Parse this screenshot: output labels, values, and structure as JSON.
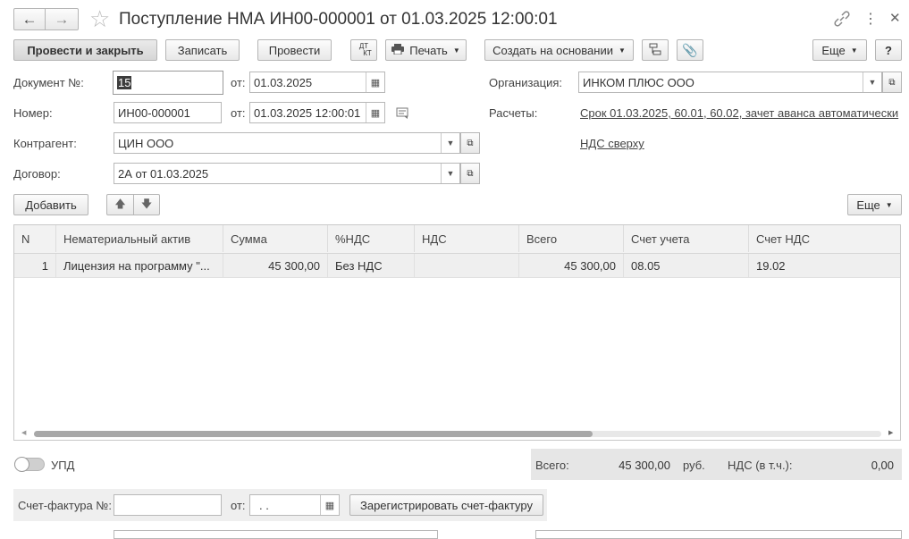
{
  "title": "Поступление НМА ИН00-000001 от 01.03.2025 12:00:01",
  "toolbar": {
    "post_close": "Провести и закрыть",
    "save": "Записать",
    "post": "Провести",
    "dtkt_top": "ДТ",
    "dtkt_bottom": "КТ",
    "print": "Печать",
    "create_based": "Создать на основании",
    "more": "Еще",
    "help": "?"
  },
  "form": {
    "doc_num_label": "Документ №:",
    "doc_num_value": "15",
    "from_label": "от:",
    "doc_date": "01.03.2025",
    "number_label": "Номер:",
    "number_value": "ИН00-000001",
    "number_date": "01.03.2025 12:00:01",
    "org_label": "Организация:",
    "org_value": "ИНКОМ ПЛЮС ООО",
    "calc_label": "Расчеты:",
    "calc_link": "Срок 01.03.2025, 60.01, 60.02, зачет аванса автоматически",
    "vat_link": "НДС сверху",
    "counterparty_label": "Контрагент:",
    "counterparty_value": "ЦИН ООО",
    "contract_label": "Договор:",
    "contract_value": "2А от 01.03.2025"
  },
  "table_toolbar": {
    "add": "Добавить",
    "more": "Еще"
  },
  "table": {
    "columns": [
      "N",
      "Нематериальный актив",
      "Сумма",
      "%НДС",
      "НДС",
      "Всего",
      "Счет учета",
      "Счет НДС"
    ],
    "rows": [
      [
        "1",
        "Лицензия на программу \"...",
        "45 300,00",
        "Без НДС",
        "",
        "45 300,00",
        "08.05",
        "19.02"
      ]
    ]
  },
  "bottom": {
    "upd_label": "УПД",
    "total_label": "Всего:",
    "total_value": "45 300,00",
    "currency": "руб.",
    "vat_label": "НДС (в т.ч.):",
    "vat_value": "0,00",
    "invoice_label": "Счет-фактура №:",
    "invoice_from": "от:",
    "invoice_date": " .  .",
    "register_btn": "Зарегистрировать счет-фактуру"
  },
  "colors": {
    "grid_header": "#f2f2f2",
    "selected_row": "#efefef",
    "total_panel": "#e6e6e6"
  },
  "icons": [
    "back-arrow-icon",
    "forward-arrow-icon",
    "star-icon",
    "link-icon",
    "kebab-icon",
    "close-icon",
    "printer-icon",
    "structure-icon",
    "paperclip-icon",
    "calendar-icon",
    "dropdown-icon",
    "open-icon",
    "comment-icon",
    "arrow-up-icon",
    "arrow-down-icon"
  ]
}
